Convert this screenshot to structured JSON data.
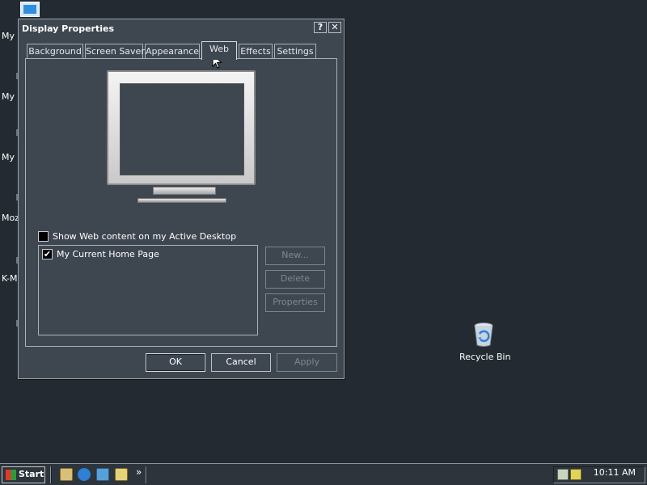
{
  "desktop": {
    "left_labels": [
      "My",
      "My D",
      "My",
      "Moz",
      "K-M"
    ],
    "recycle_bin_label": "Recycle Bin"
  },
  "window": {
    "title": "Display Properties",
    "help_button": "?",
    "close_button": "✕",
    "tabs": [
      {
        "label": "Background",
        "active": false
      },
      {
        "label": "Screen Saver",
        "active": false
      },
      {
        "label": "Appearance",
        "active": false
      },
      {
        "label": "Web",
        "active": true
      },
      {
        "label": "Effects",
        "active": false
      },
      {
        "label": "Settings",
        "active": false
      }
    ],
    "web_tab": {
      "show_web_content_label": "Show Web content on my Active Desktop",
      "show_web_content_checked": false,
      "list_items": [
        {
          "label": "My Current Home Page",
          "checked": true
        }
      ],
      "buttons": {
        "new": "New...",
        "delete": "Delete",
        "properties": "Properties"
      }
    },
    "footer_buttons": {
      "ok": "OK",
      "cancel": "Cancel",
      "apply": "Apply"
    }
  },
  "taskbar": {
    "start_label": "Start",
    "quick_launch_more": "»",
    "clock": "10:11 AM"
  }
}
